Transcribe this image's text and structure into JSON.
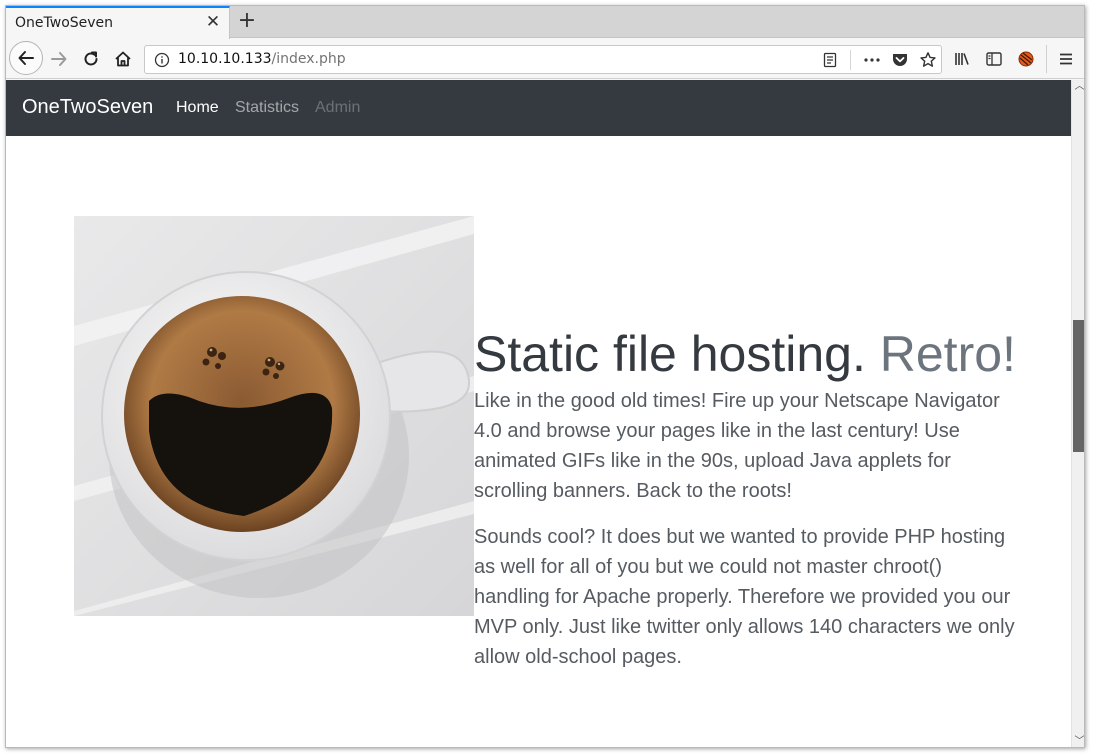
{
  "browser": {
    "tab_title": "OneTwoSeven",
    "url_host": "10.10.10.133",
    "url_path": "/index.php"
  },
  "site": {
    "brand": "OneTwoSeven",
    "nav": [
      {
        "label": "Home"
      },
      {
        "label": "Statistics"
      },
      {
        "label": "Admin"
      }
    ]
  },
  "hero": {
    "headline_main": "Static file hosting. ",
    "headline_accent": "Retro!",
    "paragraph_1": "Like in the good old times! Fire up your Netscape Navigator 4.0 and browse your pages like in the last century! Use animated GIFs like in the 90s, upload Java applets for scrolling banners. Back to the roots!",
    "paragraph_2": "Sounds cool? It does but we wanted to provide PHP hosting as well for all of you but we could not master chroot() handling for Apache properly. Therefore we provided you our MVP only. Just like twitter only allows 140 characters we only allow old-school pages."
  },
  "colors": {
    "navbar_bg": "#343a40",
    "tab_accent": "#0a84ff",
    "text_muted": "#6c757d"
  }
}
